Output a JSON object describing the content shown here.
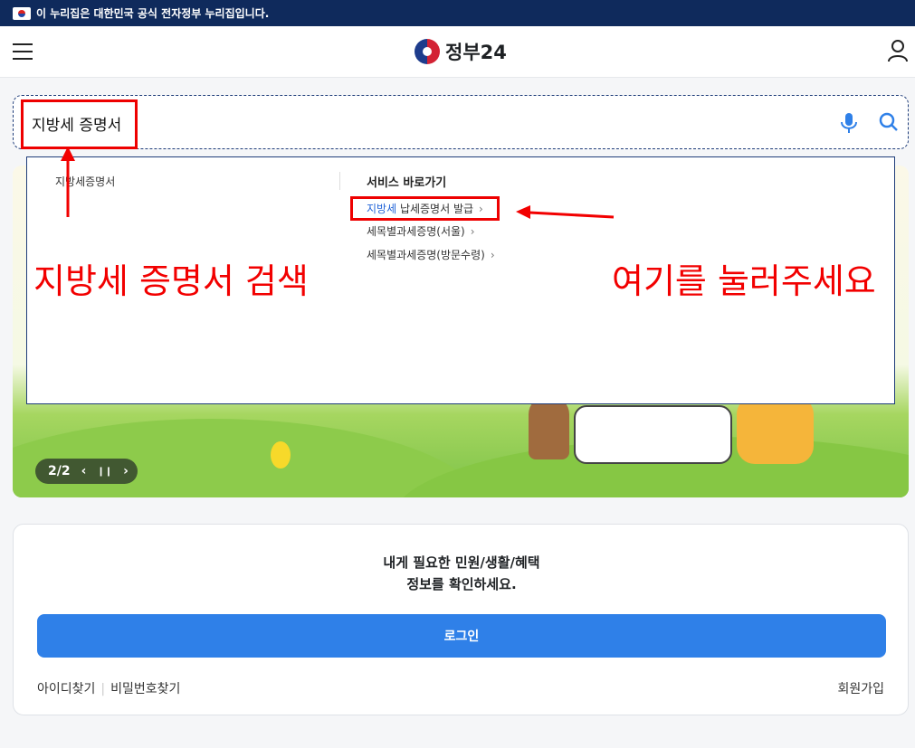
{
  "gov_banner": {
    "text": "이 누리집은 대한민국 공식 전자정부 누리집입니다."
  },
  "header": {
    "logo_text": "정부24"
  },
  "search": {
    "value": "지방세 증명서"
  },
  "suggestions": {
    "items": [
      {
        "label": "지방세증명서"
      }
    ]
  },
  "services": {
    "title": "서비스 바로가기",
    "links": [
      {
        "highlight": "지방세",
        "rest": " 납세증명서 발급"
      },
      {
        "highlight": "",
        "rest": "세목별과세증명(서울)"
      },
      {
        "highlight": "",
        "rest": "세목별과세증명(방문수령)"
      }
    ]
  },
  "banner": {
    "pager": "2/2"
  },
  "annotations": {
    "left": "지방세 증명서 검색",
    "right": "여기를 눌러주세요"
  },
  "login": {
    "message_line1": "내게 필요한 민원/생활/혜택",
    "message_line2": "정보를 확인하세요.",
    "button": "로그인",
    "find_id": "아이디찾기",
    "find_pw": "비밀번호찾기",
    "signup": "회원가입"
  },
  "colors": {
    "primary": "#2f80e8",
    "gov_bar": "#0f2a5c",
    "annotation": "#f20000",
    "highlight": "#2566d8"
  }
}
